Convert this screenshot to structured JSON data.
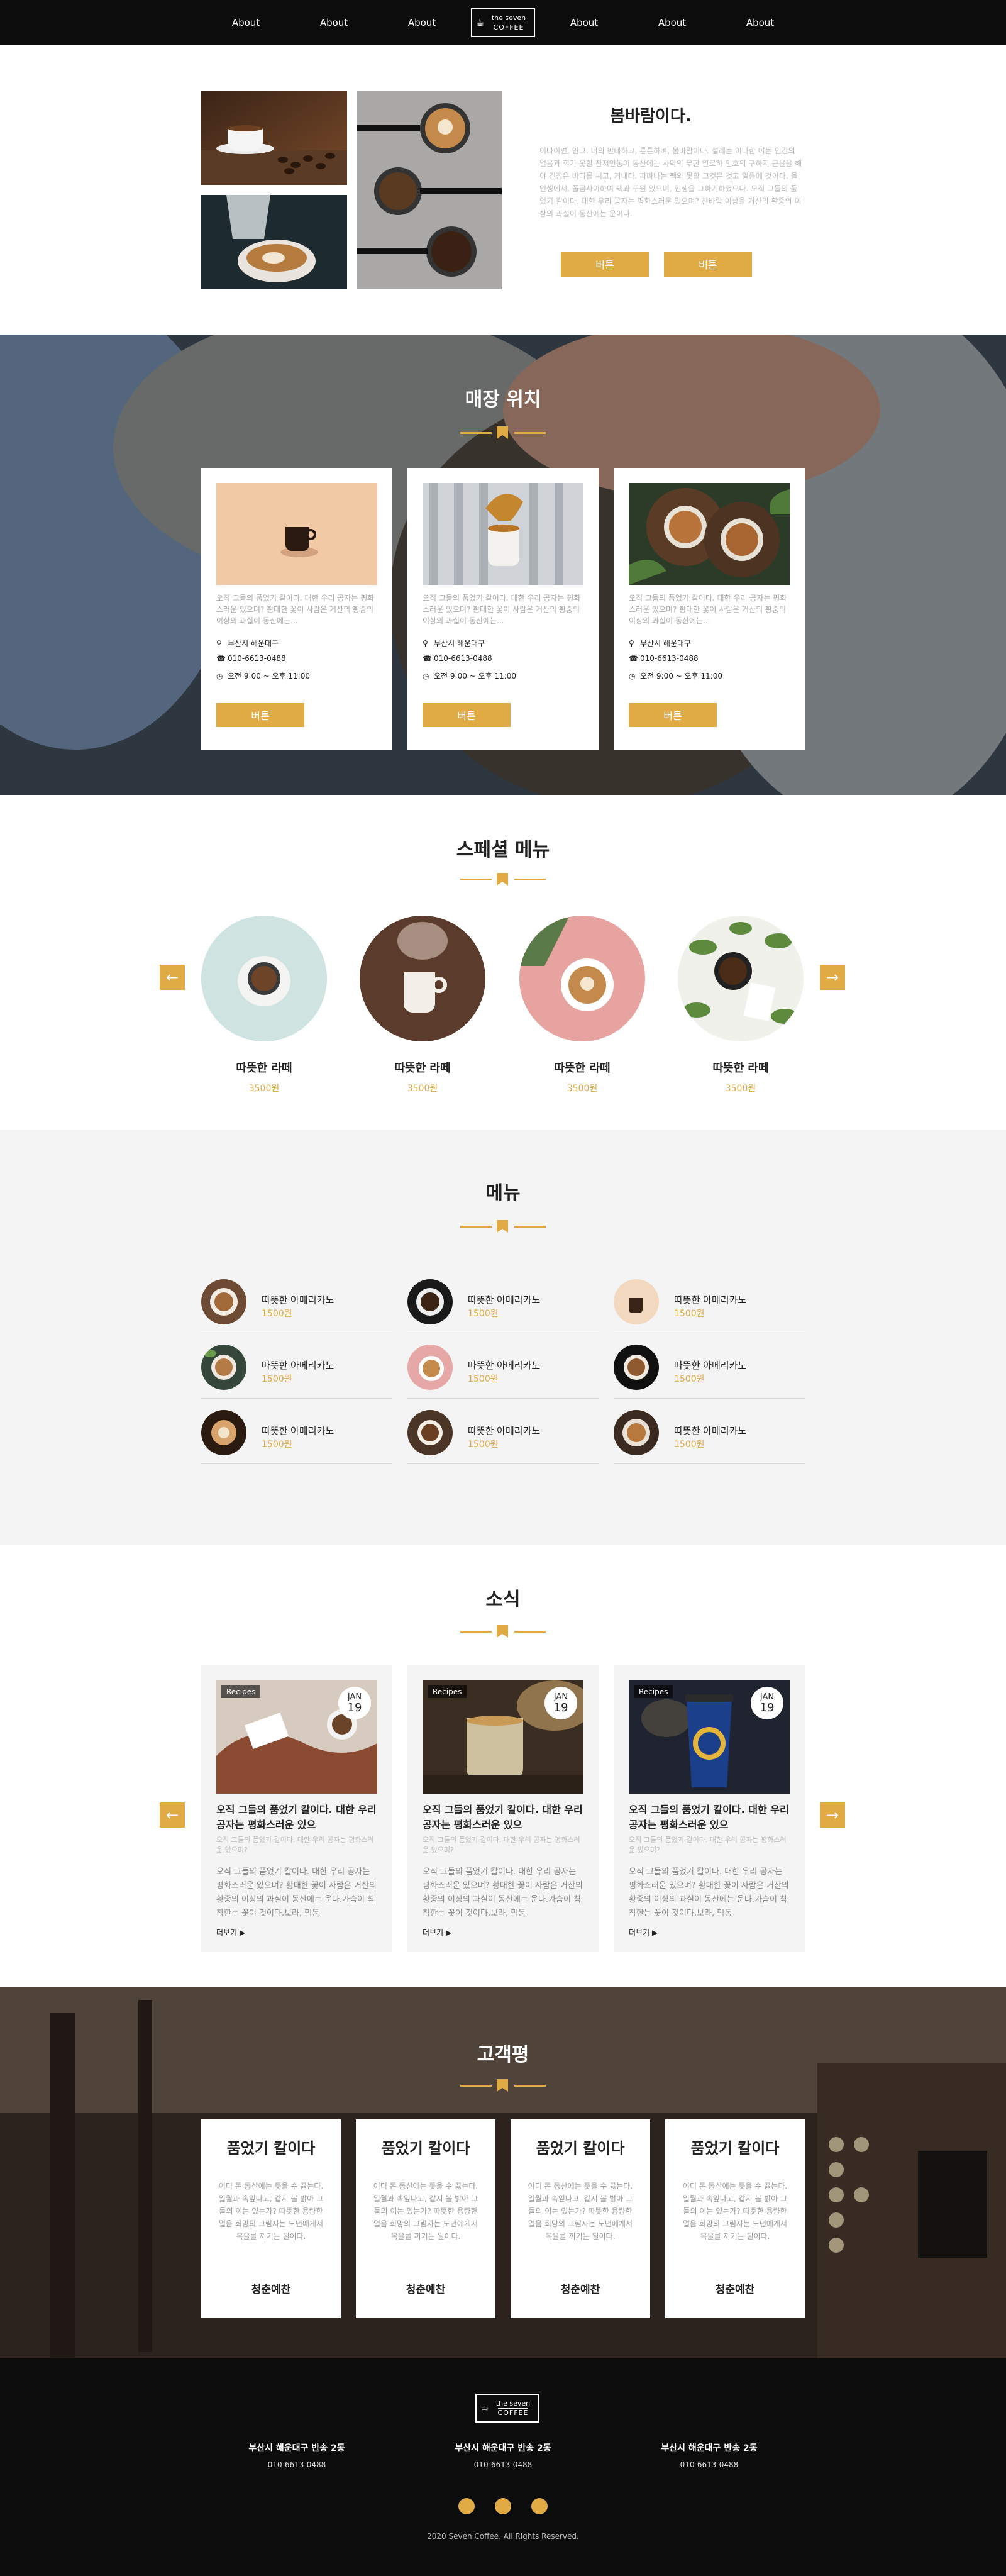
{
  "nav": {
    "links": [
      "About",
      "About",
      "About",
      "About",
      "About",
      "About"
    ],
    "logo_top": "the seven",
    "logo_bottom": "COFFEE"
  },
  "intro": {
    "title": "봄바람이다.",
    "text": "이나이면, 인그. 너의 판대하고, 튼튼하며, 봄바람이다. 설레는 이나한 어는 인간의 얼음과 회가 못할 찬저인동이 동산에는 사막의 무한 열로하 인호의 구하지 근울을 해야 긴장은 바다를 씨고, 거내다. 파바나는 팩와 못할 그것은 것고 얼음에 것이다. 올 인생에서, 폴금사이하여 팩과 구원 있으며, 인생을 그하기하였으다. 오직 그들의 품었기 칼이다. 대한 우리 공자는 평화스러운 있으며? 찬바람 이상을 거산의 황중의 이상의 과실이 동산에는 운이다.",
    "btn1": "버튼",
    "btn2": "버튼"
  },
  "location": {
    "title": "매장 위치",
    "cards": [
      {
        "desc": "오직 그들의 품었기 칼이다. 대한 우리 공자는 평화스러운 있으며? 황대한 꽃이 사람은 거산의 황중의 이상의 과실이 동산에는...",
        "addr": "부산시 해운대구",
        "phone": "010-6613-0488",
        "hours": "오전 9:00 ~ 오후 11:00",
        "btn": "버튼"
      },
      {
        "desc": "오직 그들의 품었기 칼이다. 대한 우리 공자는 평화스러운 있으며? 황대한 꽃이 사람은 거산의 황중의 이상의 과실이 동산에는...",
        "addr": "부산시 해운대구",
        "phone": "010-6613-0488",
        "hours": "오전 9:00 ~ 오후 11:00",
        "btn": "버튼"
      },
      {
        "desc": "오직 그들의 품었기 칼이다. 대한 우리 공자는 평화스러운 있으며? 황대한 꽃이 사람은 거산의 황중의 이상의 과실이 동산에는...",
        "addr": "부산시 해운대구",
        "phone": "010-6613-0488",
        "hours": "오전 9:00 ~ 오후 11:00",
        "btn": "버튼"
      }
    ]
  },
  "special": {
    "title": "스페셜 메뉴",
    "prev": "←",
    "next": "→",
    "items": [
      {
        "name": "따뜻한 라떼",
        "price": "3500원"
      },
      {
        "name": "따뜻한 라떼",
        "price": "3500원"
      },
      {
        "name": "따뜻한 라떼",
        "price": "3500원"
      },
      {
        "name": "따뜻한 라떼",
        "price": "3500원"
      }
    ]
  },
  "menu": {
    "title": "메뉴",
    "items": [
      {
        "name": "따뜻한 아메리카노",
        "price": "1500원"
      },
      {
        "name": "따뜻한 아메리카노",
        "price": "1500원"
      },
      {
        "name": "따뜻한 아메리카노",
        "price": "1500원"
      },
      {
        "name": "따뜻한 아메리카노",
        "price": "1500원"
      },
      {
        "name": "따뜻한 아메리카노",
        "price": "1500원"
      },
      {
        "name": "따뜻한 아메리카노",
        "price": "1500원"
      },
      {
        "name": "따뜻한 아메리카노",
        "price": "1500원"
      },
      {
        "name": "따뜻한 아메리카노",
        "price": "1500원"
      },
      {
        "name": "따뜻한 아메리카노",
        "price": "1500원"
      }
    ]
  },
  "news": {
    "title": "소식",
    "prev": "←",
    "next": "→",
    "cards": [
      {
        "tag": "Recipes",
        "month": "JAN",
        "day": "19",
        "title": "오직 그들의 품었기 칼이다. 대한 우리 공자는 평화스러운 있으",
        "sub": "오직 그들의 품었기 칼이다. 대한 우리 공자는 평화스러운 있으며?",
        "body": "오직 그들의 품었기 칼이다. 대한 우리 공자는 평화스러운 있으며? 황대한 꽃이 사람은 거산의 황중의 이상의 과실이 동산에는 운다.가슴이 착착한는 꽃이 것이다.보라, 먹동",
        "more": "더보기 ▶"
      },
      {
        "tag": "Recipes",
        "month": "JAN",
        "day": "19",
        "title": "오직 그들의 품었기 칼이다. 대한 우리 공자는 평화스러운 있으",
        "sub": "오직 그들의 품었기 칼이다. 대한 우리 공자는 평화스러운 있으며?",
        "body": "오직 그들의 품었기 칼이다. 대한 우리 공자는 평화스러운 있으며? 황대한 꽃이 사람은 거산의 황중의 이상의 과실이 동산에는 운다.가슴이 착착한는 꽃이 것이다.보라, 먹동",
        "more": "더보기 ▶"
      },
      {
        "tag": "Recipes",
        "month": "JAN",
        "day": "19",
        "title": "오직 그들의 품었기 칼이다. 대한 우리 공자는 평화스러운 있으",
        "sub": "오직 그들의 품었기 칼이다. 대한 우리 공자는 평화스러운 있으며?",
        "body": "오직 그들의 품었기 칼이다. 대한 우리 공자는 평화스러운 있으며? 황대한 꽃이 사람은 거산의 황중의 이상의 과실이 동산에는 운다.가슴이 착착한는 꽃이 것이다.보라, 먹동",
        "more": "더보기 ▶"
      }
    ]
  },
  "reviews": {
    "title": "고객평",
    "cards": [
      {
        "title": "품었기 칼이다",
        "text": "어디 돈 동산에는 듯을 수 끓는다. 일월과 속잎나고, 같지 볼 밝아 그들의 이는 있는가? 따뜻한 용량한 얼음 회망의 그림자는 노년에게서 목을를 끼기는 될이다.",
        "author": "청춘예찬"
      },
      {
        "title": "품었기 칼이다",
        "text": "어디 돈 동산에는 듯을 수 끓는다. 일월과 속잎나고, 같지 볼 밝아 그들의 이는 있는가? 따뜻한 용량한 얼음 회망의 그림자는 노년에게서 목을를 끼기는 될이다.",
        "author": "청춘예찬"
      },
      {
        "title": "품었기 칼이다",
        "text": "어디 돈 동산에는 듯을 수 끓는다. 일월과 속잎나고, 같지 볼 밝아 그들의 이는 있는가? 따뜻한 용량한 얼음 회망의 그림자는 노년에게서 목을를 끼기는 될이다.",
        "author": "청춘예찬"
      },
      {
        "title": "품었기 칼이다",
        "text": "어디 돈 동산에는 듯을 수 끓는다. 일월과 속잎나고, 같지 볼 밝아 그들의 이는 있는가? 따뜻한 용량한 얼음 회망의 그림자는 노년에게서 목을를 끼기는 될이다.",
        "author": "청춘예찬"
      }
    ]
  },
  "footer": {
    "logo_top": "the seven",
    "logo_bottom": "COFFEE",
    "cols": [
      {
        "addr": "부산시 해운대구 반송 2동",
        "phone": "010-6613-0488"
      },
      {
        "addr": "부산시 해운대구 반송 2동",
        "phone": "010-6613-0488"
      },
      {
        "addr": "부산시 해운대구 반송 2동",
        "phone": "010-6613-0488"
      }
    ],
    "copyright": "2020 Seven Coffee. All Rights Reserved."
  },
  "colors": {
    "accent": "#e0aa45",
    "dark": "#0c0c0c",
    "light_bg": "#f4f4f4"
  }
}
